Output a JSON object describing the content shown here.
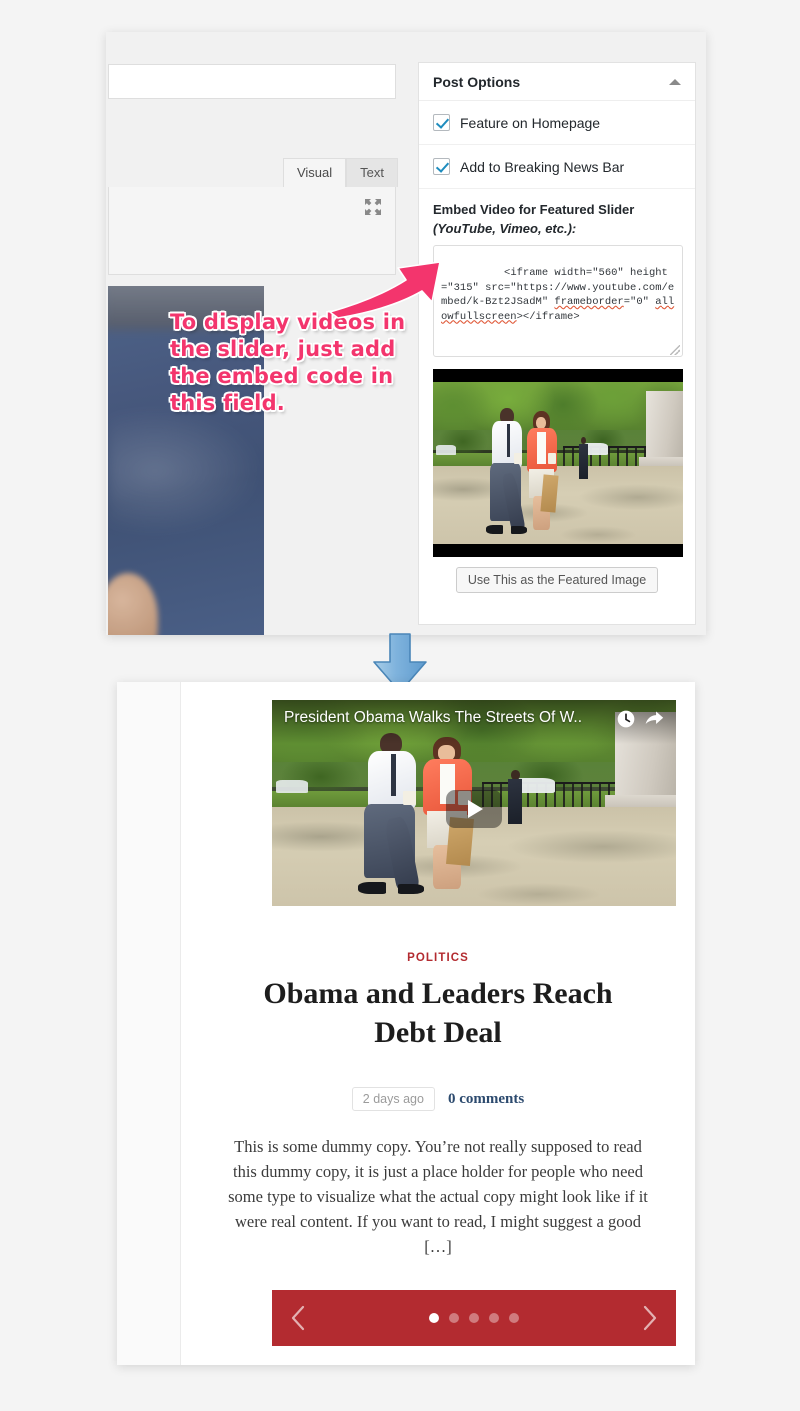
{
  "admin": {
    "editor": {
      "tab_visual": "Visual",
      "tab_text": "Text",
      "expand_icon": "fullscreen-expand-icon"
    },
    "metabox": {
      "title": "Post Options",
      "collapse_icon": "chevron-up-icon",
      "options": [
        {
          "label": "Feature on Homepage",
          "checked": true
        },
        {
          "label": "Add to Breaking News Bar",
          "checked": true
        }
      ],
      "embed_label_main": "Embed Video for Featured Slider",
      "embed_label_sub": "(YouTube, Vimeo, etc.):",
      "embed_code": "<iframe width=\"560\" height=\"315\" src=\"https://www.youtube.com/embed/k-Bzt2JSadM\" frameborder=\"0\" allowfullscreen></iframe>",
      "embed_code_parts": {
        "p1": "<iframe width=\"560\" height=\"315\" src=\"https://www.youtube.com/embed/k-Bzt2JSadM\" ",
        "misspelled_1": "frameborder",
        "p2": "=\"0\" ",
        "misspelled_2": "allowfullscreen",
        "p3": "></iframe>"
      },
      "featured_image_button": "Use This as the Featured Image"
    }
  },
  "annotation": {
    "text": "To display videos in the slider, just add the embed code in this field.",
    "color": "#f3356d",
    "arrow_icon": "pink-pointer-arrow-icon"
  },
  "flow": {
    "down_arrow_icon": "blue-down-arrow-icon",
    "down_arrow_color": "#7fb3dd"
  },
  "preview": {
    "video": {
      "title": "President Obama Walks The Streets Of W..",
      "watch_later_icon": "clock-icon",
      "share_icon": "share-arrow-icon",
      "play_icon": "play-button-icon"
    },
    "category": "POLITICS",
    "title": "Obama and Leaders Reach Debt Deal",
    "date": "2 days ago",
    "comments": "0 comments",
    "excerpt": "This is some dummy copy. You’re not really supposed to read this dummy copy, it is just a place holder for people who need some type to visualize what the actual copy might look like if it were real content. If you want to read, I might suggest a good […]",
    "slider": {
      "prev_icon": "chevron-left-icon",
      "next_icon": "chevron-right-icon",
      "dot_count": 5,
      "active_dot": 1,
      "bar_color": "#b32b30"
    }
  }
}
